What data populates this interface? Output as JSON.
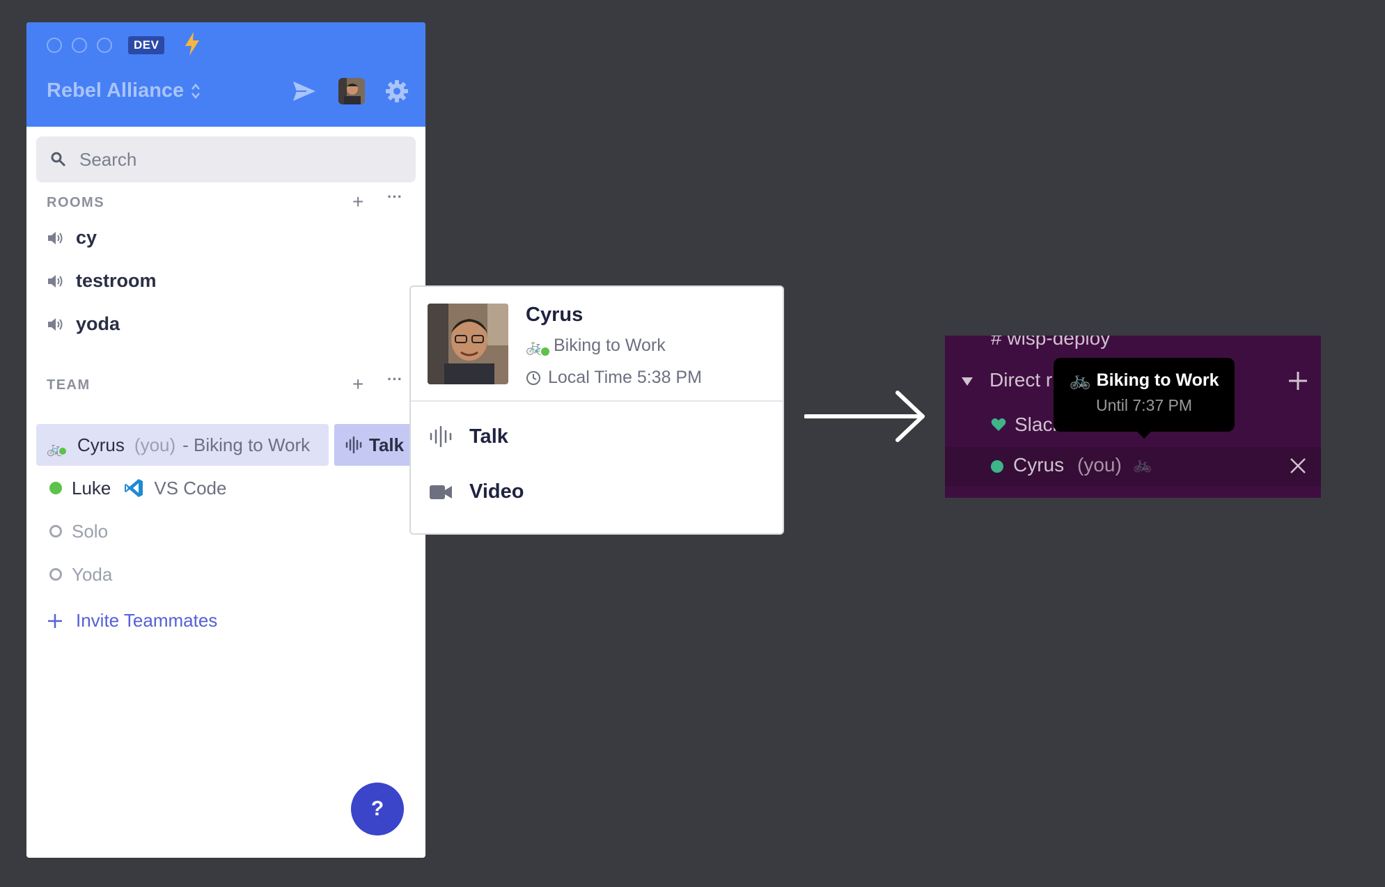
{
  "app": {
    "dev_badge": "DEV",
    "workspace_name": "Rebel Alliance",
    "search_placeholder": "Search",
    "rooms": {
      "title": "ROOMS",
      "items": [
        {
          "label": "cy"
        },
        {
          "label": "testroom"
        },
        {
          "label": "yoda"
        }
      ]
    },
    "team": {
      "title": "TEAM",
      "members": [
        {
          "name": "Cyrus",
          "you": "(you)",
          "status": "- Biking to Work",
          "emoji": "🚲"
        },
        {
          "name": "Luke",
          "app": "VS Code"
        },
        {
          "name": "Solo"
        },
        {
          "name": "Yoda"
        }
      ],
      "talk_chip": "Talk"
    },
    "invite_label": "Invite Teammates",
    "help_label": "?"
  },
  "popover": {
    "name": "Cyrus",
    "status": "Biking to Work",
    "status_emoji": "🚲",
    "local_time": "Local Time 5:38 PM",
    "actions": [
      {
        "label": "Talk"
      },
      {
        "label": "Video"
      }
    ]
  },
  "slack": {
    "top_channel": "# wisp-deploy",
    "section": "Direct r",
    "items": [
      {
        "label": "Slack"
      },
      {
        "label": "Cyrus",
        "you": "(you)"
      }
    ],
    "tooltip_title": "Biking to Work",
    "tooltip_emoji": "🚲",
    "tooltip_sub": "Until 7:37 PM"
  },
  "colors": {
    "header_blue": "#4680f4",
    "accent_indigo": "#3b45c9",
    "online_green": "#5cc24a",
    "slack_purple": "#3f0e40"
  }
}
